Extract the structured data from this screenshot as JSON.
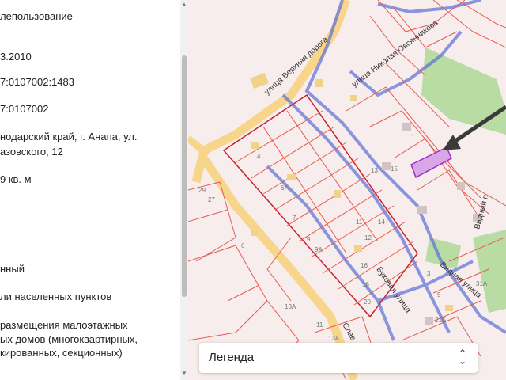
{
  "info_panel": {
    "rows": [
      {
        "text": "лепользование"
      },
      {
        "text": "3.2010"
      },
      {
        "text": "7:0107002:1483"
      },
      {
        "text": "7:0107002"
      },
      {
        "text": "нодарский край, г. Анапа, ул."
      },
      {
        "text": "азовского, 12"
      },
      {
        "text": "9 кв. м"
      },
      {
        "text": "нный"
      },
      {
        "text": "ли населенных пунктов"
      },
      {
        "text": "размещения малоэтажных"
      },
      {
        "text": "ых домов (многоквартирных,"
      },
      {
        "text": "кированных, секционных)"
      }
    ]
  },
  "map": {
    "street_labels": [
      {
        "text": "улица Верхняя дорога"
      },
      {
        "text": "улица Николая Овсянникова"
      },
      {
        "text": "Буковая улица"
      },
      {
        "text": "Видная улица"
      },
      {
        "text": "Видный п"
      },
      {
        "text": "Слав"
      }
    ],
    "lot_numbers": [
      "29",
      "27",
      "6",
      "4",
      "6А",
      "11",
      "13",
      "15",
      "9",
      "14",
      "7",
      "9А",
      "12",
      "16",
      "18",
      "20",
      "13А",
      "11",
      "13А",
      "31А",
      "21Б",
      "3",
      "5",
      "1"
    ],
    "highlight_color": "#d9a6e8",
    "parcel_line_color": "#e85a4f",
    "road_color": "#f7d58a",
    "boundary_color": "#5b6fd6"
  },
  "legend": {
    "label": "Легенда",
    "chevron_icon": "chevron-updown-icon"
  },
  "scrollbar": {
    "up_arrow": "▲",
    "down_arrow": "▼"
  },
  "chevron_up": "⌃",
  "chevron_down": "⌄"
}
